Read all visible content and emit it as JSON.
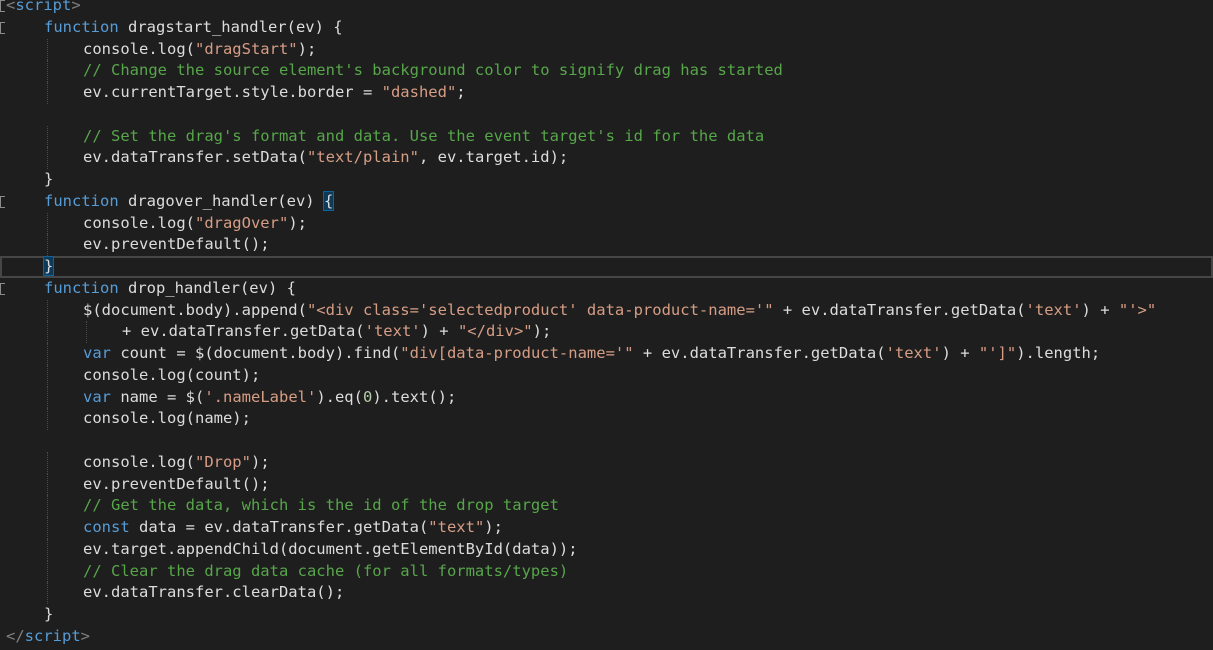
{
  "editor": {
    "language": "html",
    "lines": [
      {
        "indent": 0,
        "tokens": [
          {
            "c": "tagb",
            "t": "<"
          },
          {
            "c": "tag",
            "t": "script"
          },
          {
            "c": "tagb",
            "t": ">"
          }
        ]
      },
      {
        "indent": 1,
        "tokens": [
          {
            "c": "kw",
            "t": "function"
          },
          {
            "c": "txt",
            "t": " dragstart_handler(ev) {"
          }
        ]
      },
      {
        "indent": 2,
        "tokens": [
          {
            "c": "txt",
            "t": "console.log("
          },
          {
            "c": "str",
            "t": "\"dragStart\""
          },
          {
            "c": "txt",
            "t": ");"
          }
        ]
      },
      {
        "indent": 2,
        "tokens": [
          {
            "c": "cm",
            "t": "// Change the source element's background color to signify drag has started"
          }
        ]
      },
      {
        "indent": 2,
        "tokens": [
          {
            "c": "txt",
            "t": "ev.currentTarget.style.border = "
          },
          {
            "c": "str",
            "t": "\"dashed\""
          },
          {
            "c": "txt",
            "t": ";"
          }
        ]
      },
      {
        "indent": 0,
        "tokens": []
      },
      {
        "indent": 2,
        "tokens": [
          {
            "c": "cm",
            "t": "// Set the drag's format and data. Use the event target's id for the data"
          }
        ]
      },
      {
        "indent": 2,
        "tokens": [
          {
            "c": "txt",
            "t": "ev.dataTransfer.setData("
          },
          {
            "c": "str",
            "t": "\"text/plain\""
          },
          {
            "c": "txt",
            "t": ", ev.target.id);"
          }
        ]
      },
      {
        "indent": 1,
        "tokens": [
          {
            "c": "txt",
            "t": "}"
          }
        ]
      },
      {
        "indent": 1,
        "tokens": [
          {
            "c": "kw",
            "t": "function"
          },
          {
            "c": "txt",
            "t": " dragover_handler(ev) "
          },
          {
            "c": "brace",
            "t": "{"
          }
        ]
      },
      {
        "indent": 2,
        "tokens": [
          {
            "c": "txt",
            "t": "console.log("
          },
          {
            "c": "str",
            "t": "\"dragOver\""
          },
          {
            "c": "txt",
            "t": ");"
          }
        ]
      },
      {
        "indent": 2,
        "tokens": [
          {
            "c": "txt",
            "t": "ev.preventDefault();"
          }
        ]
      },
      {
        "indent": 1,
        "tokens": [
          {
            "c": "brace",
            "t": "}"
          }
        ]
      },
      {
        "indent": 1,
        "tokens": [
          {
            "c": "kw",
            "t": "function"
          },
          {
            "c": "txt",
            "t": " drop_handler(ev) {"
          }
        ]
      },
      {
        "indent": 2,
        "tokens": [
          {
            "c": "txt",
            "t": "$(document.body).append("
          },
          {
            "c": "str",
            "t": "\"<div class='selectedproduct' data-product-name='\""
          },
          {
            "c": "txt",
            "t": " + ev.dataTransfer.getData("
          },
          {
            "c": "str",
            "t": "'text'"
          },
          {
            "c": "txt",
            "t": ") + "
          },
          {
            "c": "str",
            "t": "\"'>\""
          }
        ]
      },
      {
        "indent": 3,
        "tokens": [
          {
            "c": "txt",
            "t": "+ ev.dataTransfer.getData("
          },
          {
            "c": "str",
            "t": "'text'"
          },
          {
            "c": "txt",
            "t": ") + "
          },
          {
            "c": "str",
            "t": "\"</div>\""
          },
          {
            "c": "txt",
            "t": ");"
          }
        ]
      },
      {
        "indent": 2,
        "tokens": [
          {
            "c": "kw",
            "t": "var"
          },
          {
            "c": "txt",
            "t": " count = $(document.body).find("
          },
          {
            "c": "str",
            "t": "\"div[data-product-name='\""
          },
          {
            "c": "txt",
            "t": " + ev.dataTransfer.getData("
          },
          {
            "c": "str",
            "t": "'text'"
          },
          {
            "c": "txt",
            "t": ") + "
          },
          {
            "c": "str",
            "t": "\"']\""
          },
          {
            "c": "txt",
            "t": ").length;"
          }
        ]
      },
      {
        "indent": 2,
        "tokens": [
          {
            "c": "txt",
            "t": "console.log(count);"
          }
        ]
      },
      {
        "indent": 2,
        "tokens": [
          {
            "c": "kw",
            "t": "var"
          },
          {
            "c": "txt",
            "t": " name = $("
          },
          {
            "c": "str",
            "t": "'.nameLabel'"
          },
          {
            "c": "txt",
            "t": ").eq("
          },
          {
            "c": "num",
            "t": "0"
          },
          {
            "c": "txt",
            "t": ").text();"
          }
        ]
      },
      {
        "indent": 2,
        "tokens": [
          {
            "c": "txt",
            "t": "console.log(name);"
          }
        ]
      },
      {
        "indent": 0,
        "tokens": []
      },
      {
        "indent": 2,
        "tokens": [
          {
            "c": "txt",
            "t": "console.log("
          },
          {
            "c": "str",
            "t": "\"Drop\""
          },
          {
            "c": "txt",
            "t": ");"
          }
        ]
      },
      {
        "indent": 2,
        "tokens": [
          {
            "c": "txt",
            "t": "ev.preventDefault();"
          }
        ]
      },
      {
        "indent": 2,
        "tokens": [
          {
            "c": "cm",
            "t": "// Get the data, which is the id of the drop target"
          }
        ]
      },
      {
        "indent": 2,
        "tokens": [
          {
            "c": "kw",
            "t": "const"
          },
          {
            "c": "txt",
            "t": " data = ev.dataTransfer.getData("
          },
          {
            "c": "str",
            "t": "\"text\""
          },
          {
            "c": "txt",
            "t": ");"
          }
        ]
      },
      {
        "indent": 2,
        "tokens": [
          {
            "c": "txt",
            "t": "ev.target.appendChild(document.getElementById(data));"
          }
        ]
      },
      {
        "indent": 2,
        "tokens": [
          {
            "c": "cm",
            "t": "// Clear the drag data cache (for all formats/types)"
          }
        ]
      },
      {
        "indent": 2,
        "tokens": [
          {
            "c": "txt",
            "t": "ev.dataTransfer.clearData();"
          }
        ]
      },
      {
        "indent": 1,
        "tokens": [
          {
            "c": "txt",
            "t": "}"
          }
        ]
      },
      {
        "indent": 0,
        "tokens": [
          {
            "c": "tagb",
            "t": "</"
          },
          {
            "c": "tag",
            "t": "script"
          },
          {
            "c": "tagb",
            "t": ">"
          }
        ]
      }
    ],
    "current_line": 12,
    "collapse_lines": [
      0,
      1,
      9,
      13
    ],
    "colors": {
      "background": "#1e1e1e",
      "keyword": "#569cd6",
      "string": "#d69d85",
      "comment": "#57a64a",
      "text": "#dcdcdc"
    }
  }
}
